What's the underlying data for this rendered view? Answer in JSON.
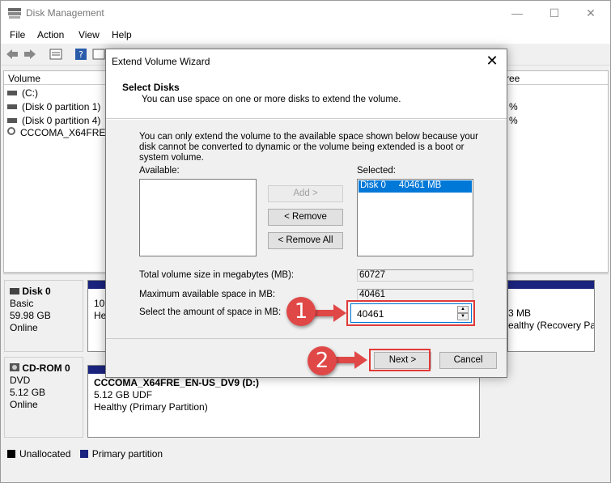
{
  "window": {
    "title": "Disk Management"
  },
  "menu": [
    "File",
    "Action",
    "View",
    "Help"
  ],
  "volume_list": {
    "headers": {
      "volume": "Volume",
      "free_pct": "ree"
    },
    "rows": [
      {
        "name": "(C:)",
        "pct": "%"
      },
      {
        "name": "(Disk 0 partition 1)",
        "pct": "%"
      },
      {
        "name": "(Disk 0 partition 4)",
        "pct": "%"
      },
      {
        "name": "CCCOMA_X64FRE...",
        "pct": ""
      }
    ]
  },
  "disks": [
    {
      "name": "Disk 0",
      "type": "Basic",
      "size": "59.98 GB",
      "status": "Online"
    },
    {
      "name": "CD-ROM 0",
      "type": "DVD",
      "size": "5.12 GB",
      "status": "Online"
    }
  ],
  "disk0_partitions": {
    "left": {
      "line1": "10",
      "line2": "He"
    },
    "right": {
      "line1": "3 MB",
      "line2": "ealthy (Recovery Pa"
    }
  },
  "cdrom_partition": {
    "name": "CCCOMA_X64FRE_EN-US_DV9  (D:)",
    "size": "5.12 GB UDF",
    "status": "Healthy (Primary Partition)"
  },
  "legend": {
    "unallocated": "Unallocated",
    "primary": "Primary partition"
  },
  "dialog": {
    "title": "Extend Volume Wizard",
    "heading": "Select Disks",
    "subheading": "You can use space on one or more disks to extend the volume.",
    "info": "You can only extend the volume to the available space shown below because your disk cannot be converted to dynamic or the volume being extended is a boot or system volume.",
    "available_label": "Available:",
    "selected_label": "Selected:",
    "selected_item": "Disk 0     40461 MB",
    "add_button": "Add >",
    "remove_button": "< Remove",
    "remove_all_button": "< Remove All",
    "total_label": "Total volume size in megabytes (MB):",
    "total_value": "60727",
    "max_label": "Maximum available space in MB:",
    "max_value": "40461",
    "amount_label": "Select the amount of space in MB:",
    "amount_value": "40461",
    "next_button": "Next >",
    "cancel_button": "Cancel"
  },
  "annotations": {
    "step1": "1",
    "step2": "2"
  },
  "colors": {
    "accent": "#0078d7",
    "annotation": "#e04848",
    "partition": "#1a237e"
  }
}
